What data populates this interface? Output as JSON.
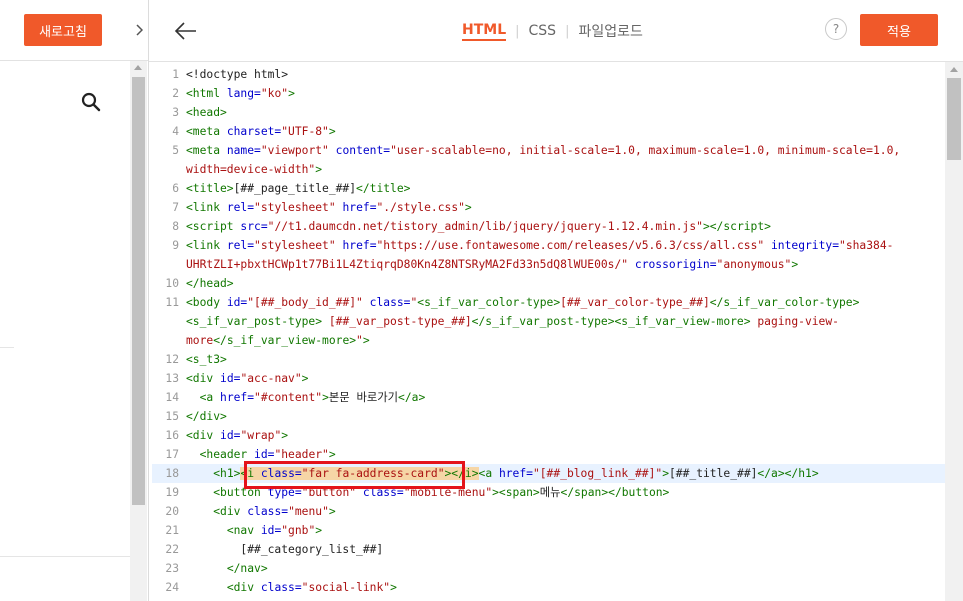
{
  "left": {
    "refresh_label": "새로고침"
  },
  "header": {
    "tabs": [
      "HTML",
      "CSS",
      "파일업로드"
    ],
    "active_tab": "HTML",
    "help_label": "?",
    "apply_label": "적용"
  },
  "code": {
    "highlighted_line": 18,
    "lines": [
      {
        "n": "1",
        "html": "<span class='x'>&lt;!doctype html&gt;</span>"
      },
      {
        "n": "2",
        "html": "<span class='t'>&lt;html</span> <span class='a'>lang=</span><span class='s'>\"ko\"</span><span class='t'>&gt;</span>"
      },
      {
        "n": "3",
        "html": "<span class='t'>&lt;head&gt;</span>"
      },
      {
        "n": "4",
        "html": "<span class='t'>&lt;meta</span> <span class='a'>charset=</span><span class='s'>\"UTF-8\"</span><span class='t'>&gt;</span>"
      },
      {
        "n": "5",
        "html": "<span class='t'>&lt;meta</span> <span class='a'>name=</span><span class='s'>\"viewport\"</span> <span class='a'>content=</span><span class='s'>\"user-scalable=no, initial-scale=1.0, maximum-scale=1.0, minimum-scale=1.0,</span>"
      },
      {
        "n": "",
        "html": "<span class='s'>width=device-width\"</span><span class='t'>&gt;</span>"
      },
      {
        "n": "6",
        "html": "<span class='t'>&lt;title&gt;</span>[##_page_title_##]<span class='t'>&lt;/title&gt;</span>"
      },
      {
        "n": "7",
        "html": "<span class='t'>&lt;link</span> <span class='a'>rel=</span><span class='s'>\"stylesheet\"</span> <span class='a'>href=</span><span class='s'>\"./style.css\"</span><span class='t'>&gt;</span>"
      },
      {
        "n": "8",
        "html": "<span class='t'>&lt;script</span> <span class='a'>src=</span><span class='s'>\"//t1.daumcdn.net/tistory_admin/lib/jquery/jquery-1.12.4.min.js\"</span><span class='t'>&gt;&lt;/script&gt;</span>"
      },
      {
        "n": "9",
        "html": "<span class='t'>&lt;link</span> <span class='a'>rel=</span><span class='s'>\"stylesheet\"</span> <span class='a'>href=</span><span class='s'>\"https://use.fontawesome.com/releases/v5.6.3/css/all.css\"</span> <span class='a'>integrity=</span><span class='s'>\"sha384-</span>"
      },
      {
        "n": "",
        "html": "<span class='s'>UHRtZLI+pbxtHCWp1t77Bi1L4ZtiqrqD80Kn4Z8NTSRyMA2Fd33n5dQ8lWUE00s/\"</span> <span class='a'>crossorigin=</span><span class='s'>\"anonymous\"</span><span class='t'>&gt;</span>"
      },
      {
        "n": "10",
        "html": "<span class='t'>&lt;/head&gt;</span>"
      },
      {
        "n": "11",
        "html": "<span class='t'>&lt;body</span> <span class='a'>id=</span><span class='s'>\"[##_body_id_##]\"</span> <span class='a'>class=</span><span class='s'>\"</span><span class='t'>&lt;s_if_var_color-type&gt;</span><span class='s'>[##_var_color-type_##]</span><span class='t'>&lt;/s_if_var_color-type&gt;</span>"
      },
      {
        "n": "",
        "html": "<span class='t'>&lt;s_if_var_post-type&gt;</span> <span class='s'>[##_var_post-type_##]</span><span class='t'>&lt;/s_if_var_post-type&gt;&lt;s_if_var_view-more&gt;</span> <span class='s'>paging-view-</span>"
      },
      {
        "n": "",
        "html": "<span class='s'>more</span><span class='t'>&lt;/s_if_var_view-more&gt;</span><span class='s'>\"</span><span class='t'>&gt;</span>"
      },
      {
        "n": "12",
        "html": "<span class='t'>&lt;s_t3&gt;</span>"
      },
      {
        "n": "13",
        "html": "<span class='t'>&lt;div</span> <span class='a'>id=</span><span class='s'>\"acc-nav\"</span><span class='t'>&gt;</span>"
      },
      {
        "n": "14",
        "html": "  <span class='t'>&lt;a</span> <span class='a'>href=</span><span class='s'>\"#content\"</span><span class='t'>&gt;</span>본문 바로가기<span class='t'>&lt;/a&gt;</span>"
      },
      {
        "n": "15",
        "html": "<span class='t'>&lt;/div&gt;</span>"
      },
      {
        "n": "16",
        "html": "<span class='t'>&lt;div</span> <span class='a'>id=</span><span class='s'>\"wrap\"</span><span class='t'>&gt;</span>"
      },
      {
        "n": "17",
        "html": "  <span class='t'>&lt;header</span> <span class='a'>id=</span><span class='s'>\"header\"</span><span class='t'>&gt;</span>"
      },
      {
        "n": "18",
        "html": "    <span class='t'>&lt;h1&gt;</span><span class='hl'><span class='t'>&lt;i</span> <span class='a'>class=</span><span class='s'>\"far fa-address-card\"</span><span class='t'>&gt;&lt;/i&gt;</span></span><span class='t'>&lt;a</span> <span class='a'>href=</span><span class='s'>\"[##_blog_link_##]\"</span><span class='t'>&gt;</span>[##_title_##]<span class='t'>&lt;/a&gt;&lt;/h1&gt;</span>"
      },
      {
        "n": "19",
        "html": "    <span class='t'>&lt;button</span> <span class='a'>type=</span><span class='s'>\"button\"</span> <span class='a'>class=</span><span class='s'>\"mobile-menu\"</span><span class='t'>&gt;&lt;span&gt;</span>메뉴<span class='t'>&lt;/span&gt;&lt;/button&gt;</span>"
      },
      {
        "n": "20",
        "html": "    <span class='t'>&lt;div</span> <span class='a'>class=</span><span class='s'>\"menu\"</span><span class='t'>&gt;</span>"
      },
      {
        "n": "21",
        "html": "      <span class='t'>&lt;nav</span> <span class='a'>id=</span><span class='s'>\"gnb\"</span><span class='t'>&gt;</span>"
      },
      {
        "n": "22",
        "html": "        [##_category_list_##]"
      },
      {
        "n": "23",
        "html": "      <span class='t'>&lt;/nav&gt;</span>"
      },
      {
        "n": "24",
        "html": "      <span class='t'>&lt;div</span> <span class='a'>class=</span><span class='s'>\"social-link\"</span><span class='t'>&gt;</span>"
      }
    ]
  },
  "colors": {
    "accent": "#f0592a",
    "annotation": "#e4141b"
  }
}
